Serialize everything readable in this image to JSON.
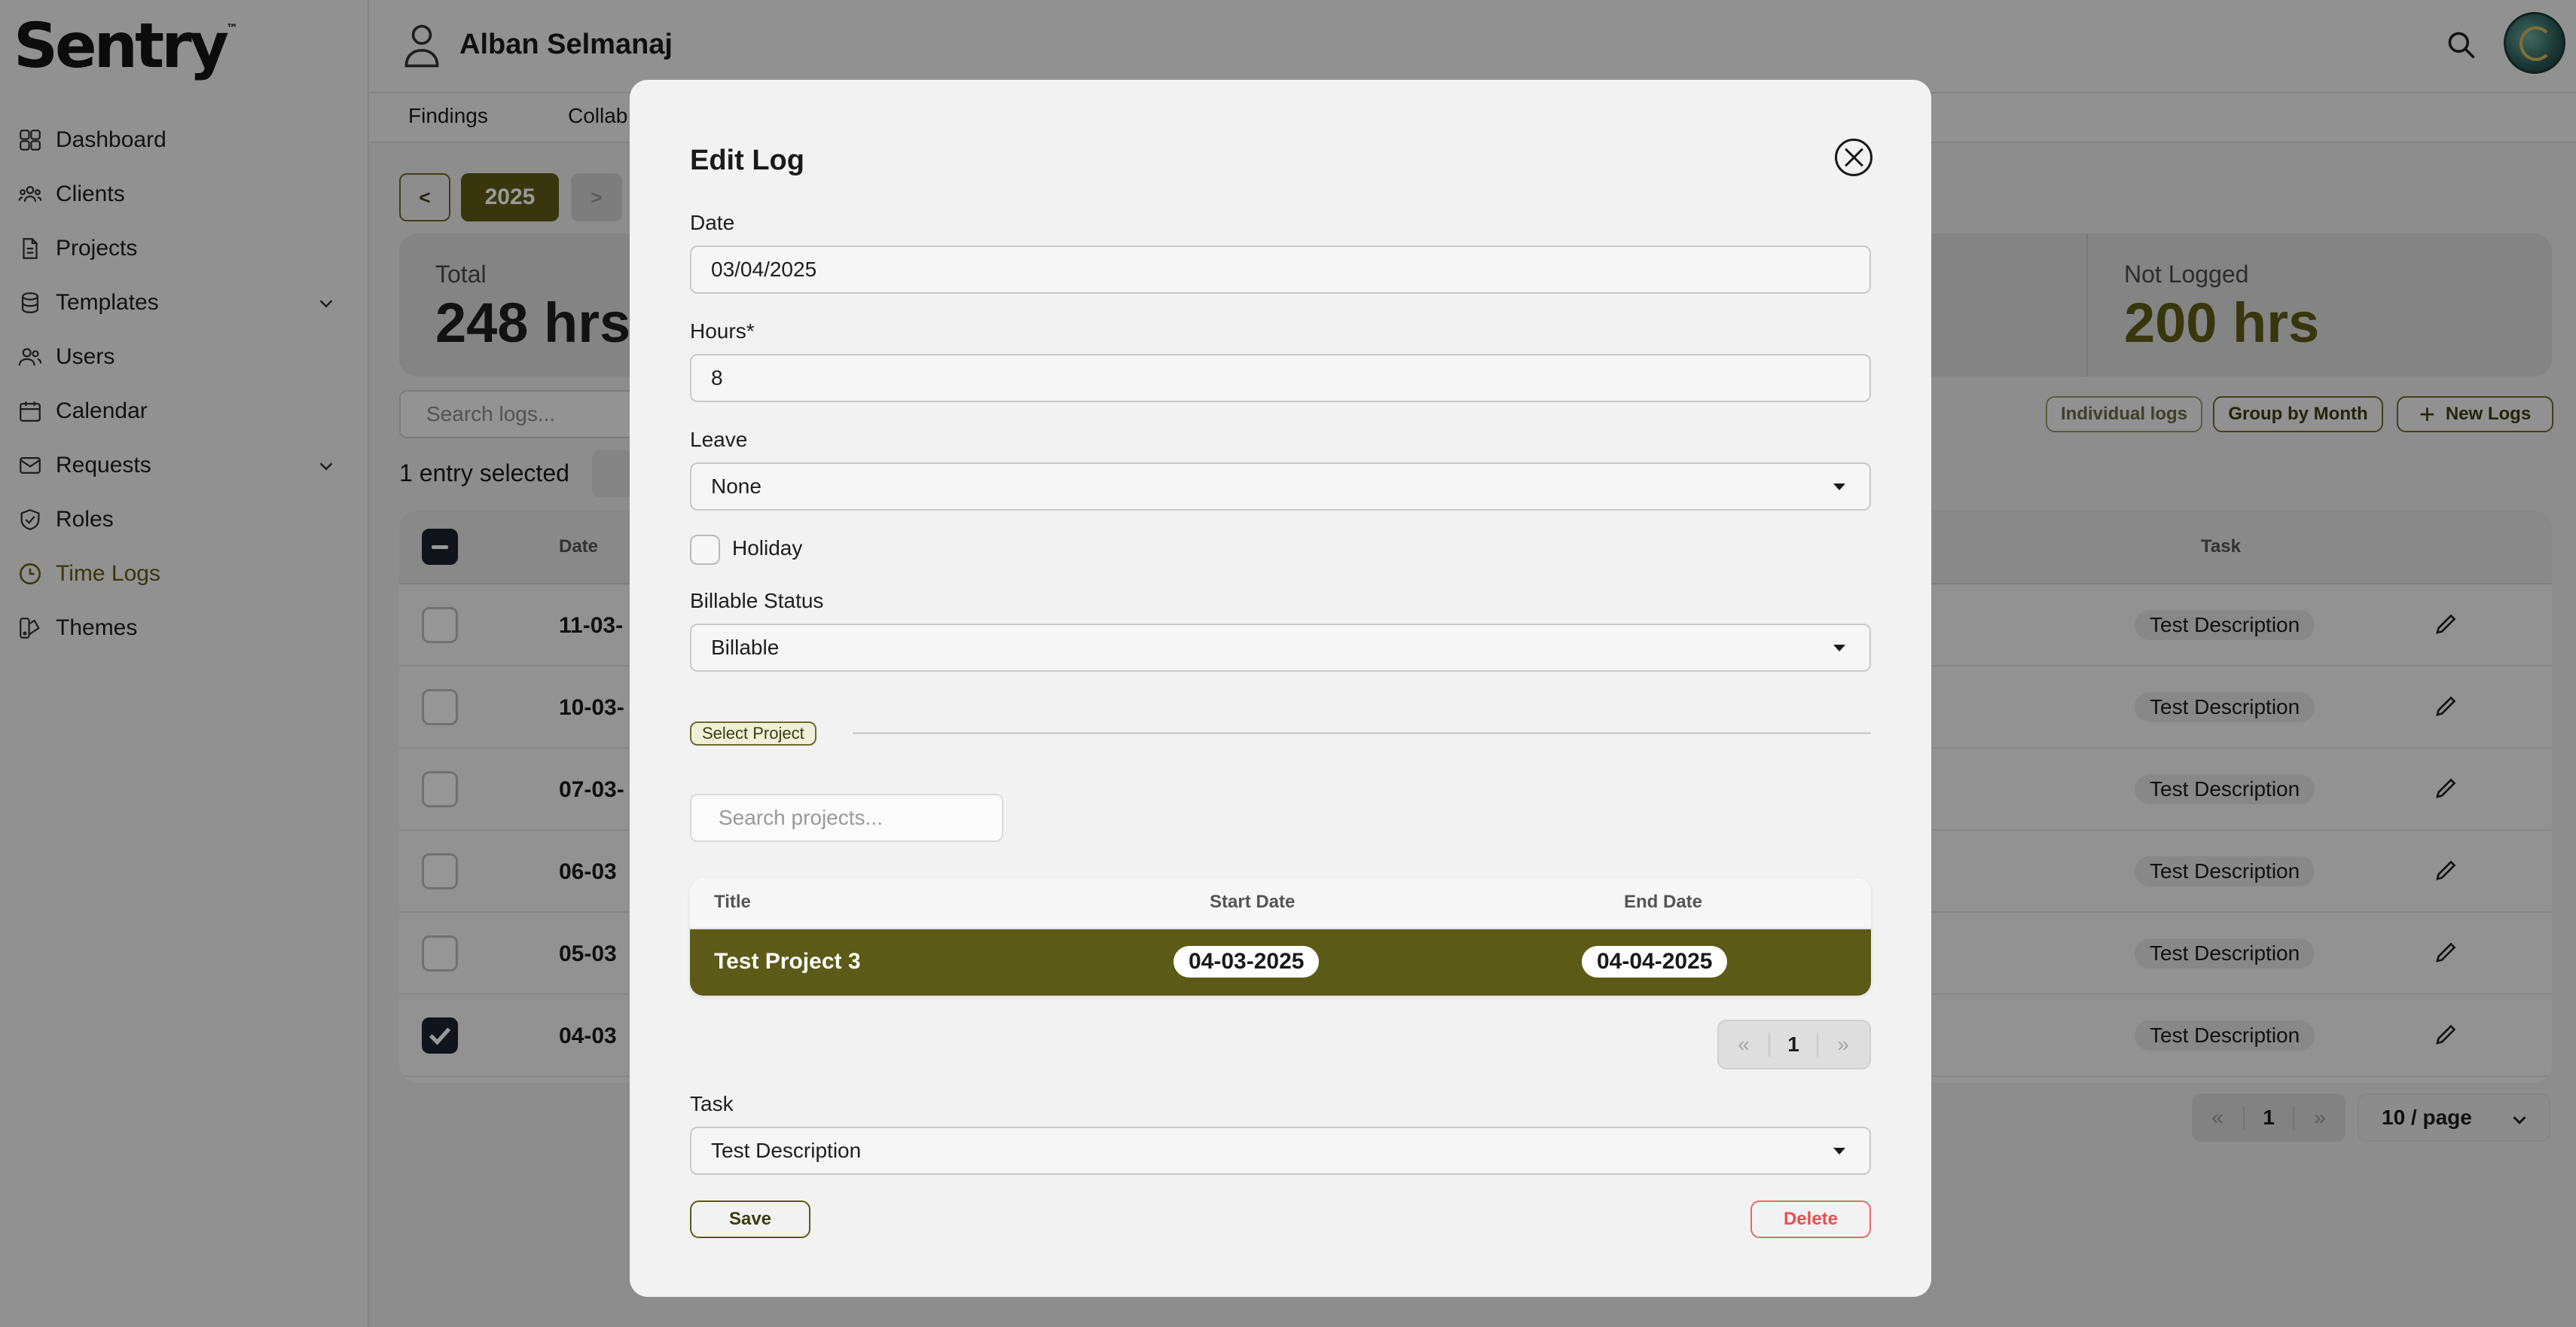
{
  "app": {
    "logo": "Sentry",
    "logo_mark": "™"
  },
  "sidebar": {
    "items": [
      {
        "label": "Dashboard",
        "icon": "grid-icon"
      },
      {
        "label": "Clients",
        "icon": "people-icon"
      },
      {
        "label": "Projects",
        "icon": "document-icon"
      },
      {
        "label": "Templates",
        "icon": "database-icon",
        "expandable": true
      },
      {
        "label": "Users",
        "icon": "users-icon"
      },
      {
        "label": "Calendar",
        "icon": "calendar-icon"
      },
      {
        "label": "Requests",
        "icon": "mail-icon",
        "expandable": true
      },
      {
        "label": "Roles",
        "icon": "shield-icon"
      },
      {
        "label": "Time Logs",
        "icon": "clock-icon",
        "active": true
      },
      {
        "label": "Themes",
        "icon": "palette-icon"
      }
    ],
    "active_color": "#5f5c12"
  },
  "header": {
    "user_name": "Alban Selmanaj"
  },
  "subnav": {
    "tabs": [
      "Findings",
      "Collab"
    ]
  },
  "timelogs": {
    "year_prev": "<",
    "year": "2025",
    "year_next": ">",
    "total_label": "Total",
    "total_value": "248 hrs",
    "not_logged_label": "Not Logged",
    "not_logged_value": "200 hrs",
    "search_placeholder": "Search logs...",
    "individual_logs": "Individual logs",
    "group_by_month": "Group by Month",
    "new_logs": "New Logs",
    "selection_text": "1 entry selected",
    "columns": {
      "date": "Date",
      "task": "Task"
    },
    "rows": [
      {
        "date": "11-03-",
        "task": "Test Description",
        "checked": false
      },
      {
        "date": "10-03-",
        "task": "Test Description",
        "checked": false
      },
      {
        "date": "07-03-",
        "task": "Test Description",
        "checked": false
      },
      {
        "date": "06-03",
        "task": "Test Description",
        "checked": false
      },
      {
        "date": "05-03",
        "task": "Test Description",
        "checked": false
      },
      {
        "date": "04-03",
        "task": "Test Description",
        "checked": true
      }
    ],
    "pager": {
      "prev": "«",
      "page": "1",
      "next": "»"
    },
    "per_page": "10 / page"
  },
  "modal": {
    "title": "Edit Log",
    "date_label": "Date",
    "date_value": "03/04/2025",
    "hours_label": "Hours*",
    "hours_value": "8",
    "leave_label": "Leave",
    "leave_value": "None",
    "holiday_label": "Holiday",
    "billable_label": "Billable Status",
    "billable_value": "Billable",
    "select_project": "Select Project",
    "search_projects_placeholder": "Search projects...",
    "project_columns": {
      "title": "Title",
      "start": "Start Date",
      "end": "End Date"
    },
    "project_row": {
      "title": "Test Project 3",
      "start": "04-03-2025",
      "end": "04-04-2025"
    },
    "pager": {
      "prev": "«",
      "page": "1",
      "next": "»"
    },
    "task_label": "Task",
    "task_value": "Test Description",
    "save": "Save",
    "delete": "Delete"
  },
  "colors": {
    "accent": "#5c5a17",
    "danger": "#e05252",
    "dark_checkbox": "#1e2230"
  }
}
